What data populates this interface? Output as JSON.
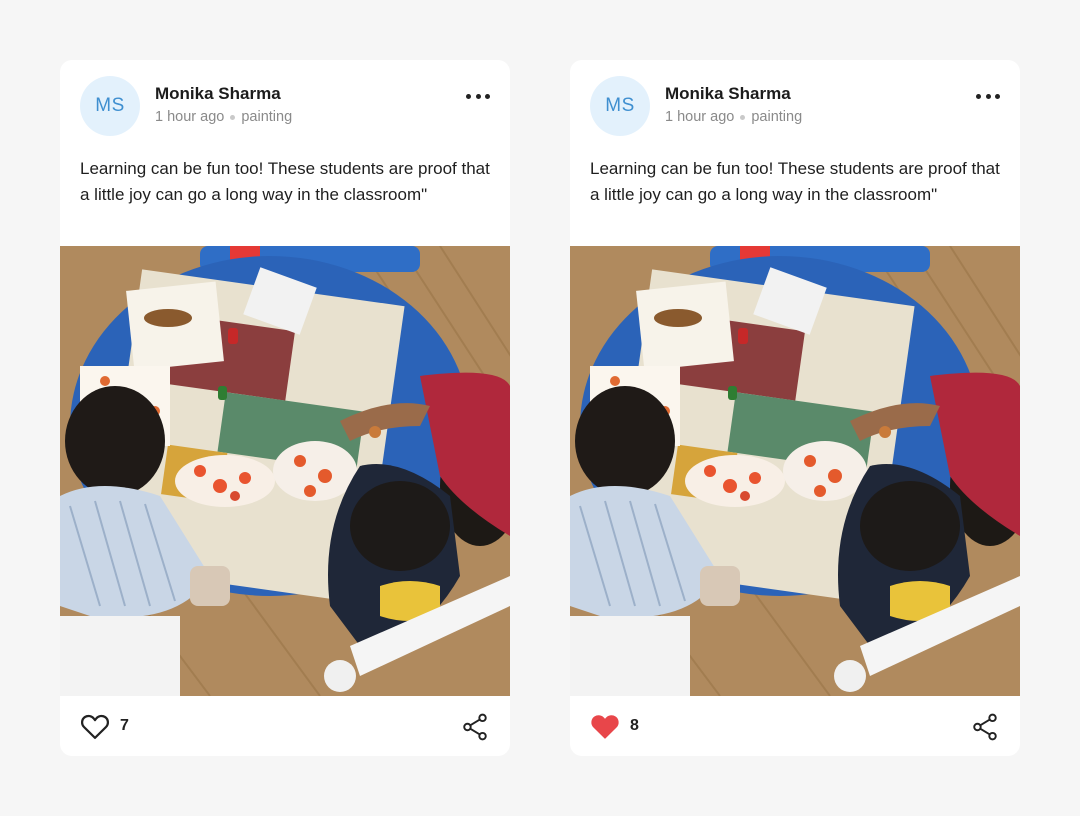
{
  "posts": [
    {
      "author": {
        "initials": "MS",
        "name": "Monika Sharma"
      },
      "time": "1 hour ago",
      "tag": "painting",
      "text": "Learning can be fun too! These students are proof that a little joy can go a long way in the classroom\"",
      "likes": {
        "count": "7",
        "liked": false,
        "icon": "heart-outline-icon"
      },
      "share_icon": "share-icon",
      "more_icon": "more-icon",
      "image": "classroom painting photo"
    },
    {
      "author": {
        "initials": "MS",
        "name": "Monika Sharma"
      },
      "time": "1 hour ago",
      "tag": "painting",
      "text": "Learning can be fun too! These students are proof that a little joy can go a long way in the classroom\"",
      "likes": {
        "count": "8",
        "liked": true,
        "icon": "heart-filled-icon"
      },
      "share_icon": "share-icon",
      "more_icon": "more-icon",
      "image": "classroom painting photo"
    }
  ],
  "colors": {
    "background": "#f6f6f6",
    "card": "#ffffff",
    "avatar_bg": "#e3f1fc",
    "avatar_text": "#3f8fd0",
    "heart_liked": "#e8464a"
  }
}
